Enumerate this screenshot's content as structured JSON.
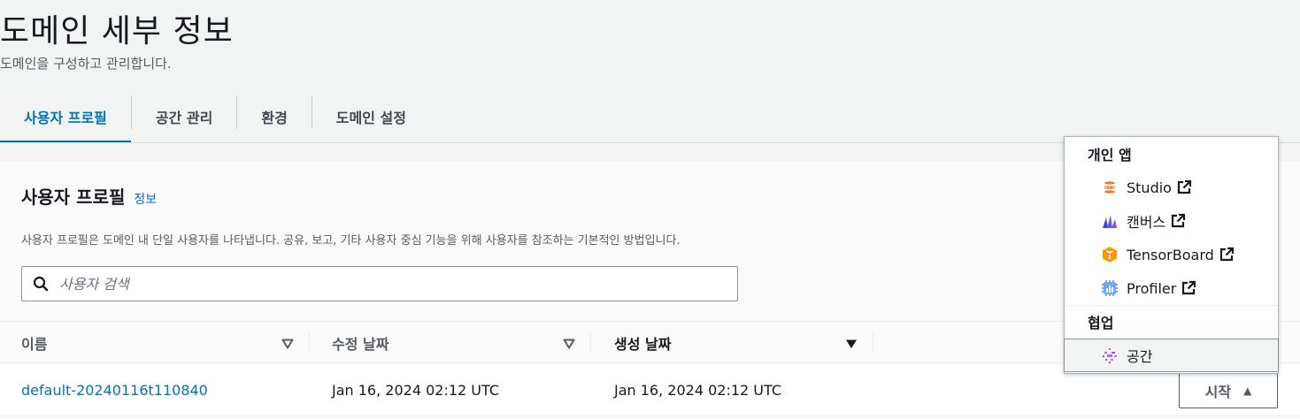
{
  "header": {
    "title": "도메인 세부 정보",
    "description": "도메인을 구성하고 관리합니다."
  },
  "tabs": [
    {
      "label": "사용자 프로필",
      "active": true
    },
    {
      "label": "공간 관리",
      "active": false
    },
    {
      "label": "환경",
      "active": false
    },
    {
      "label": "도메인 설정",
      "active": false
    }
  ],
  "panel": {
    "title": "사용자 프로필",
    "info_link": "정보",
    "description": "사용자 프로필은 도메인 내 단일 사용자를 나타냅니다. 공유, 보고, 기타 사용자 중심 기능을 위해 사용자를 참조하는 기본적인 방법입니다.",
    "search_placeholder": "사용자 검색"
  },
  "table": {
    "columns": [
      {
        "label": "이름",
        "sort": "none"
      },
      {
        "label": "수정 날짜",
        "sort": "none"
      },
      {
        "label": "생성 날짜",
        "sort": "descending"
      }
    ],
    "rows": [
      {
        "name": "default-20240116t110840",
        "modified": "Jan 16, 2024 02:12 UTC",
        "created": "Jan 16, 2024 02:12 UTC"
      }
    ]
  },
  "launch": {
    "button_label": "시작",
    "groups": [
      {
        "label": "개인 앱",
        "items": [
          {
            "label": "Studio",
            "icon": "jupyter-icon",
            "external": true
          },
          {
            "label": "캔버스",
            "icon": "canvas-icon",
            "external": true
          },
          {
            "label": "TensorBoard",
            "icon": "tensorboard-icon",
            "external": true
          },
          {
            "label": "Profiler",
            "icon": "profiler-icon",
            "external": true
          }
        ]
      },
      {
        "label": "협업",
        "items": [
          {
            "label": "공간",
            "icon": "spaces-icon",
            "external": false
          }
        ]
      }
    ]
  },
  "colors": {
    "accent": "#0073bb",
    "text": "#16191f",
    "muted": "#545b64"
  }
}
